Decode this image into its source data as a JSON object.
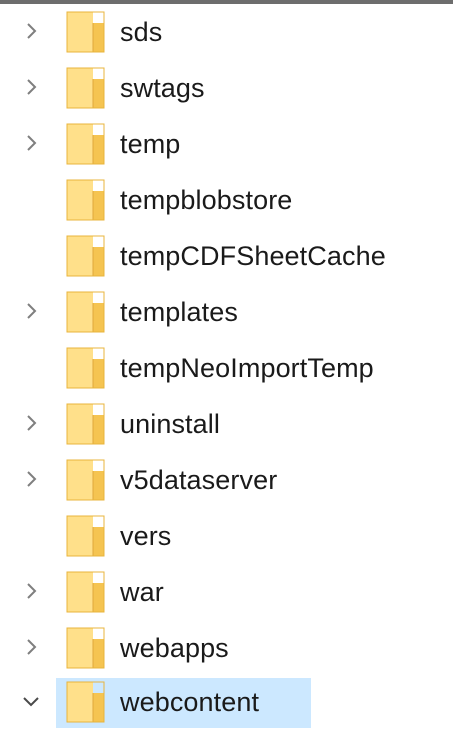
{
  "tree": {
    "items": [
      {
        "label": "sds",
        "expander": "collapsed",
        "icon": "folder-icon"
      },
      {
        "label": "swtags",
        "expander": "collapsed",
        "icon": "folder-icon"
      },
      {
        "label": "temp",
        "expander": "collapsed",
        "icon": "folder-icon"
      },
      {
        "label": "tempblobstore",
        "expander": "none",
        "icon": "folder-icon"
      },
      {
        "label": "tempCDFSheetCache",
        "expander": "none",
        "icon": "folder-icon"
      },
      {
        "label": "templates",
        "expander": "collapsed",
        "icon": "folder-icon"
      },
      {
        "label": "tempNeoImportTemp",
        "expander": "none",
        "icon": "folder-icon"
      },
      {
        "label": "uninstall",
        "expander": "collapsed",
        "icon": "folder-icon"
      },
      {
        "label": "v5dataserver",
        "expander": "collapsed",
        "icon": "folder-icon"
      },
      {
        "label": "vers",
        "expander": "none",
        "icon": "folder-icon"
      },
      {
        "label": "war",
        "expander": "collapsed",
        "icon": "folder-icon"
      },
      {
        "label": "webapps",
        "expander": "collapsed",
        "icon": "folder-icon"
      },
      {
        "label": "webcontent",
        "expander": "expanded",
        "icon": "folder-icon",
        "selected": true
      }
    ]
  },
  "colors": {
    "selection": "#cce8ff",
    "folder_fill": "#ffe08a",
    "folder_edge": "#e8b43c",
    "chevron": "#7f7f7f",
    "text": "#1a1a1a"
  }
}
